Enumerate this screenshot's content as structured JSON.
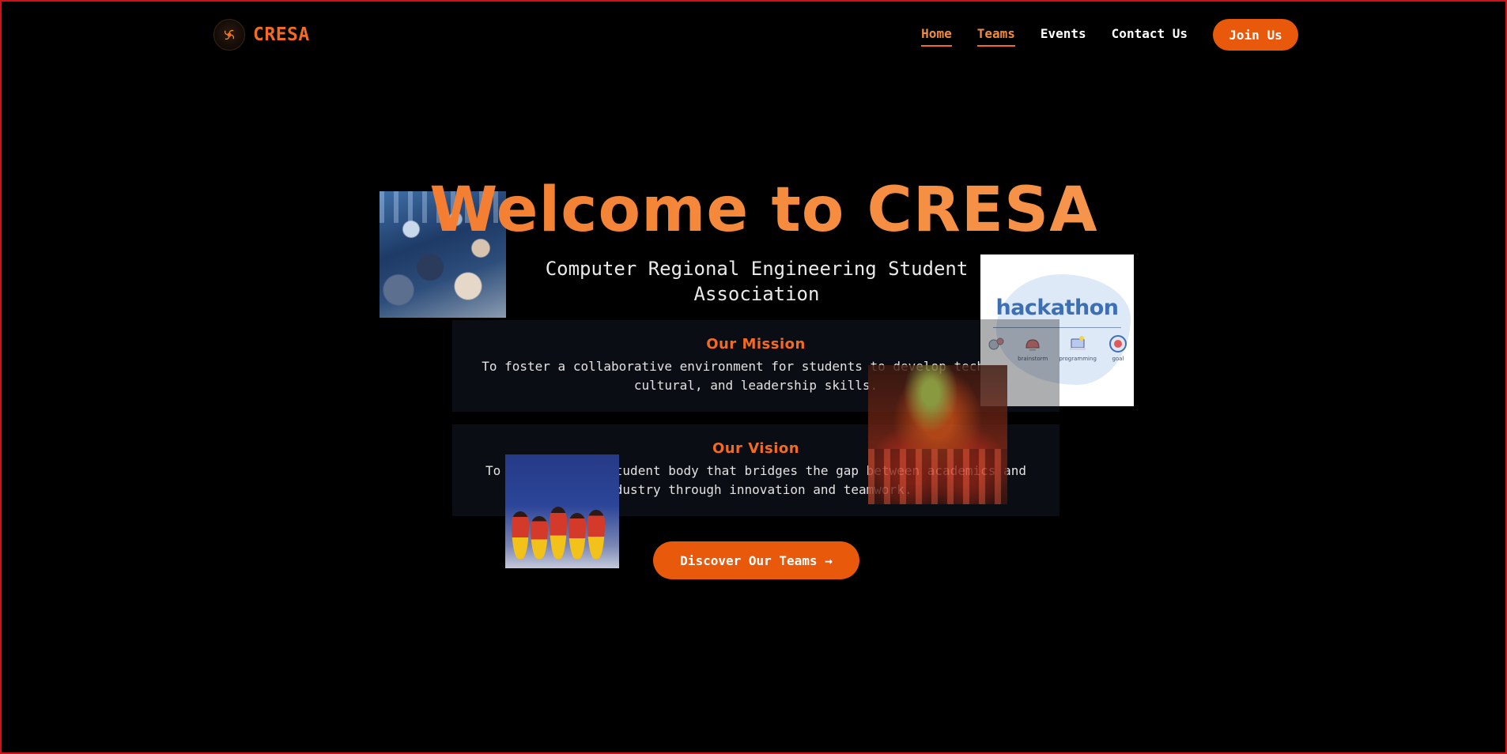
{
  "nav": {
    "brand": "CRESA",
    "logo_icon": "spiral-logo-icon",
    "links": [
      {
        "label": "Home",
        "active": true
      },
      {
        "label": "Teams",
        "active": false
      },
      {
        "label": "Events",
        "active": false
      },
      {
        "label": "Contact Us",
        "active": false
      }
    ],
    "join_label": "Join Us"
  },
  "hero": {
    "title": "Welcome to CRESA",
    "subtitle": "Computer Regional Engineering Student Association",
    "mission_title": "Our Mission",
    "mission_text": "To foster a collaborative environment for students to develop technical, cultural, and leadership skills.",
    "vision_title": "Our Vision",
    "vision_text": "To be a leading student body that bridges the gap between academics and industry through innovation and teamwork.",
    "cta_label": "Discover Our Teams →"
  },
  "photos": {
    "hackathon": {
      "title": "hackathon",
      "labels": [
        "",
        "brainstorm",
        "programming",
        "goal"
      ]
    }
  },
  "colors": {
    "accent": "#e8590c",
    "brand": "#f26b21",
    "background": "#000000",
    "card": "#0b0d14"
  }
}
